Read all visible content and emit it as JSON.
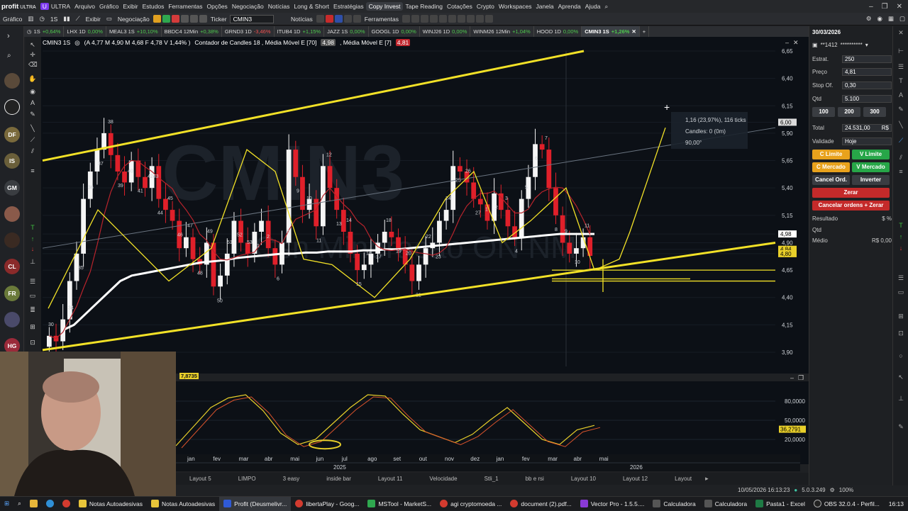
{
  "app": {
    "name": "profit",
    "edition": "ULTRA"
  },
  "menu": [
    "Arquivo",
    "Gráfico",
    "Exibir",
    "Estudos",
    "Ferramentas",
    "Opções",
    "Negociação",
    "Notícias",
    "Long & Short",
    "Estratégias",
    "Copy Invest",
    "Tape Reading",
    "Cotações",
    "Crypto",
    "Workspaces",
    "Janela",
    "Aprenda",
    "Ajuda"
  ],
  "toolbar": {
    "grafico": "Gráfico",
    "timeframe": "1S",
    "exibir": "Exibir",
    "negociacao": "Negociação",
    "ticker_label": "Ticker",
    "ticker_value": "CMIN3",
    "noticias": "Notícias",
    "ferramentas": "Ferramentas"
  },
  "tabs": [
    {
      "label": "",
      "change": "+0,64%",
      "pos": true
    },
    {
      "label": "LHX 1D",
      "change": "0,00%",
      "pos": true
    },
    {
      "label": "MEAL3 1S",
      "change": "+10,10%",
      "pos": true
    },
    {
      "label": "BBDC4 12Min",
      "change": "+0,38%",
      "pos": true
    },
    {
      "label": "GRND3 1D",
      "change": "-3,46%",
      "pos": false
    },
    {
      "label": "ITUB4 1D",
      "change": "+1,15%",
      "pos": true
    },
    {
      "label": "JAZZ 1S",
      "change": "0,00%",
      "pos": true
    },
    {
      "label": "GOOGL 1D",
      "change": "0,00%",
      "pos": true
    },
    {
      "label": "WINJ26 1D",
      "change": "0,00%",
      "pos": true
    },
    {
      "label": "WINM26 12Min",
      "change": "+1,04%",
      "pos": true
    },
    {
      "label": "HOOD 1D",
      "change": "0,00%",
      "pos": true
    },
    {
      "label": "CMIN3 1S",
      "change": "+1,26%",
      "pos": true,
      "active": true
    }
  ],
  "chart_header": {
    "symbol": "CMIN3 1S",
    "ohlc": "(A 4,77 M 4,90 M 4,68 F 4,78 V 1,44% )",
    "study": "Contador de Candles  18 , Média Móvel E [70]",
    "ma70": "4,98",
    "ma7_label": ", Média Móvel E [7]",
    "ma7": "4,81"
  },
  "watermark": {
    "ticker": "CMIN3",
    "name": "Csn Mineracao ON NM"
  },
  "chart_data": {
    "type": "candlestick",
    "y_ticks": [
      "6,65",
      "6,40",
      "6,15",
      "6,00",
      "5,90",
      "5,65",
      "5,40",
      "5,15",
      "4,98",
      "4,90",
      "4,84",
      "4,80",
      "4,65",
      "4,40",
      "4,15",
      "3,90"
    ],
    "price_markers": {
      "last": "4,84",
      "ma7": "4,80",
      "ma70": "4,98",
      "cursor": "6,00"
    },
    "x_months": [
      "jan",
      "fev",
      "mar",
      "abr",
      "mai",
      "jun",
      "jul",
      "ago",
      "set",
      "out",
      "nov",
      "dez",
      "jan",
      "fev",
      "mar",
      "abr",
      "mai"
    ],
    "years": [
      "2025",
      "2026"
    ],
    "candle_counts": [
      "30",
      "33",
      "34",
      "35",
      "36",
      "37",
      "38",
      "39",
      "40",
      "41",
      "4243",
      "44",
      "45",
      "46",
      "47",
      "48",
      "49",
      "50",
      "51",
      "52",
      "53",
      "1",
      "2",
      "6",
      "8",
      "9",
      "10",
      "11",
      "12",
      "13",
      "14",
      "15",
      "16",
      "17",
      "18",
      "19",
      "20",
      "21",
      "22",
      "23",
      "24",
      "25",
      "26",
      "27",
      "1",
      "2",
      "3",
      "4",
      "5",
      "6",
      "7",
      "8",
      "9",
      "10",
      "11"
    ],
    "measure": {
      "line1": "1,16 (23,97%), 116 ticks",
      "line2": "Candles: 0 (0m)",
      "line3": "90,00°"
    },
    "closes": [
      4.05,
      4.0,
      4.2,
      4.55,
      4.8,
      5.3,
      5.55,
      5.75,
      5.9,
      5.7,
      5.55,
      5.45,
      5.65,
      5.5,
      5.4,
      5.6,
      5.3,
      5.2,
      5.1,
      4.85,
      4.95,
      4.75,
      4.7,
      4.9,
      4.5,
      4.6,
      4.8,
      5.1,
      4.9,
      4.8,
      5.0,
      5.1,
      4.85,
      4.7,
      4.9,
      5.75,
      5.5,
      5.2,
      5.3,
      5.05,
      5.6,
      5.4,
      5.2,
      5.0,
      4.8,
      4.65,
      4.7,
      4.8,
      4.9,
      5.0,
      4.95,
      4.85,
      4.7,
      4.55,
      4.7,
      4.85,
      4.9,
      5.1,
      5.2,
      5.6,
      5.55,
      5.45,
      5.3,
      5.25,
      5.1,
      5.35,
      5.2,
      5.05,
      4.95,
      5.3,
      5.5,
      5.8,
      5.75,
      5.4,
      5.15,
      4.9,
      4.8,
      4.85,
      4.95,
      4.78
    ],
    "ma70_closes": [
      4.1,
      4.15,
      4.25,
      4.35,
      4.45,
      4.55,
      4.6,
      4.62,
      4.64,
      4.66,
      4.68,
      4.7,
      4.72,
      4.73,
      4.74,
      4.76,
      4.77,
      4.78,
      4.79,
      4.8,
      4.8,
      4.81,
      4.81,
      4.82,
      4.82,
      4.82,
      4.83,
      4.83,
      4.84,
      4.84,
      4.85,
      4.86,
      4.87,
      4.88,
      4.89,
      4.9,
      4.91,
      4.92,
      4.93,
      4.94,
      4.95,
      4.96,
      4.97,
      4.98,
      4.98,
      4.98,
      4.98
    ],
    "oscillator": {
      "values": [
        10,
        40,
        70,
        85,
        90,
        65,
        30,
        12,
        20,
        45,
        70,
        90,
        88,
        60,
        35,
        25,
        15,
        28,
        50,
        70,
        45,
        20,
        12,
        35,
        42
      ],
      "value": "7,8735",
      "last": "36,2791",
      "levels": [
        "80,0000",
        "50,0000",
        "20,0000"
      ]
    }
  },
  "right_panel": {
    "date": "30/03/2026",
    "account": "**1412",
    "account_mask": "**********",
    "estrat_label": "Estrat.",
    "estrat": "250",
    "preco_label": "Preço",
    "preco": "4,81",
    "stop_label": "Stop Of.",
    "stop": "0,30",
    "qtd_label": "Qtd",
    "qtd": "5.100",
    "quick": [
      "100",
      "200",
      "300"
    ],
    "total_label": "Total",
    "total": "24.531,00",
    "total_unit": "R$",
    "validade_label": "Validade",
    "validade": "Hoje",
    "c_limite": "C Limite",
    "v_limite": "V Limite",
    "c_mercado": "C Mercado",
    "v_mercado": "V Mercado",
    "cancel_ord": "Cancel Ord.",
    "inverter": "Inverter",
    "zerar": "Zerar",
    "cancelar_zerar": "Cancelar ordens + Zerar",
    "resultado": "Resultado",
    "res_qtd": "Qtd",
    "medio": "Médio",
    "medio_val": "R$ 0,00",
    "res_unit": "$",
    "res_pct": "%"
  },
  "layouts": [
    "Layout 5",
    "LIMPO",
    "3 easy",
    "inside bar",
    "Layout 11",
    "Velocidade",
    "Stli_1",
    "bb e rsi",
    "Layout 10",
    "Layout 12",
    "Layout"
  ],
  "status": {
    "datetime": "10/05/2026 16:13:23",
    "version": "5.0.3.249",
    "zoom": "100%"
  },
  "sidebar_avatars": [
    "DF",
    "IS",
    "GM",
    "CL",
    "FR",
    "HG"
  ],
  "taskbar": [
    "Notas Autoadesivas",
    "Notas Autoadesivas",
    "Profit (Deusmelivr...",
    "libertaPlay - Goog...",
    "MSTool - MarketS...",
    "agi cryptomoeda ...",
    "document (2).pdf...",
    "Vector Pro - 1.5.5....",
    "Calculadora",
    "Calculadora",
    "Pasta1 - Excel",
    "OBS 32.0.4 - Perfil..."
  ],
  "clock": "16:13",
  "colors": {
    "bull": "#f5f5f5",
    "bear": "#e0202a",
    "trend": "#f2e127",
    "ma70": "#ffffff",
    "ma7": "#b8242c"
  }
}
